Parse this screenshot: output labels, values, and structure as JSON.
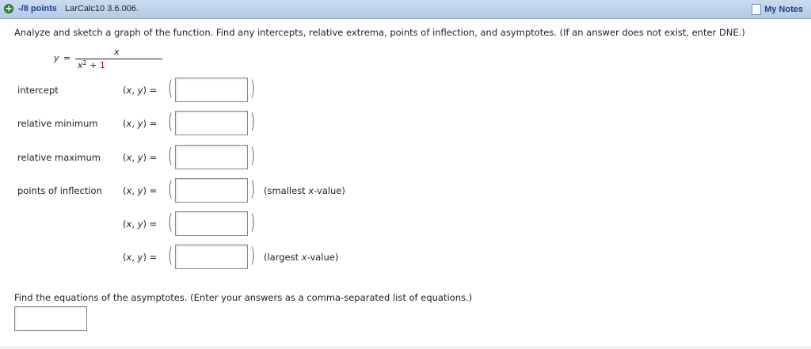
{
  "header": {
    "points": "-/8 points",
    "problem_id": "LarCalc10 3.6.006.",
    "my_notes": "My Notes"
  },
  "instructions": "Analyze and sketch a graph of the function. Find any intercepts, relative extrema, points of inflection, and asymptotes. (If an answer does not exist, enter DNE.)",
  "function": {
    "lhs": "y",
    "equals": "=",
    "numerator": "x",
    "den_var": "x",
    "den_exp": "2",
    "den_plus": "+",
    "den_const": "1"
  },
  "rows": [
    {
      "label": "intercept",
      "xy": "(x, y) =",
      "value": "",
      "note": ""
    },
    {
      "label": "relative minimum",
      "xy": "(x, y) =",
      "value": "",
      "note": ""
    },
    {
      "label": "relative maximum",
      "xy": "(x, y) =",
      "value": "",
      "note": ""
    },
    {
      "label": "points of inflection",
      "xy": "(x, y) =",
      "value": "",
      "note_pre": "(smallest ",
      "note_var": "x",
      "note_post": "-value)"
    },
    {
      "label": "",
      "xy": "(x, y) =",
      "value": "",
      "note": ""
    },
    {
      "label": "",
      "xy": "(x, y) =",
      "value": "",
      "note_pre": "(largest ",
      "note_var": "x",
      "note_post": "-value)"
    }
  ],
  "asymptotes": {
    "prompt": "Find the equations of the asymptotes. (Enter your answers as a comma-separated list of equations.)",
    "value": ""
  },
  "colors": {
    "header_bg": "#c9dbf0",
    "link": "#1f3f8c",
    "plus_icon": "#3d8a3d",
    "red_const": "#c00000"
  }
}
